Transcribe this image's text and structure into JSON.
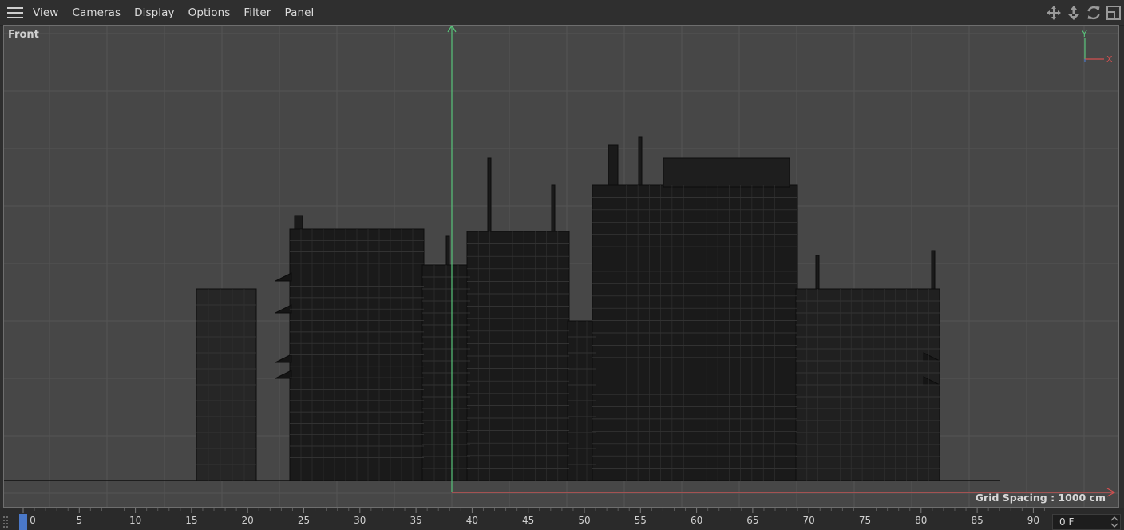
{
  "menu": {
    "items": [
      "View",
      "Cameras",
      "Display",
      "Options",
      "Filter",
      "Panel"
    ]
  },
  "nav_icons": [
    "move-view-icon",
    "dolly-view-icon",
    "rotate-view-icon",
    "switch-view-icon"
  ],
  "viewport": {
    "view_name": "Front",
    "grid_spacing_text": "Grid Spacing : 1000 cm",
    "axis_labels": {
      "y": "Y",
      "x": "X"
    },
    "colors": {
      "background": "#474747",
      "grid": "#545454",
      "y_axis": "#58c47a",
      "x_axis": "#d45050",
      "geometry": "#111111"
    }
  },
  "timeline": {
    "ticks": [
      "0",
      "5",
      "10",
      "15",
      "20",
      "25",
      "30",
      "35",
      "40",
      "45",
      "50",
      "55",
      "60",
      "65",
      "70",
      "75",
      "80",
      "85",
      "90"
    ],
    "current_frame": "0",
    "frame_field_value": "0 F",
    "playhead_color": "#4a78c8"
  }
}
